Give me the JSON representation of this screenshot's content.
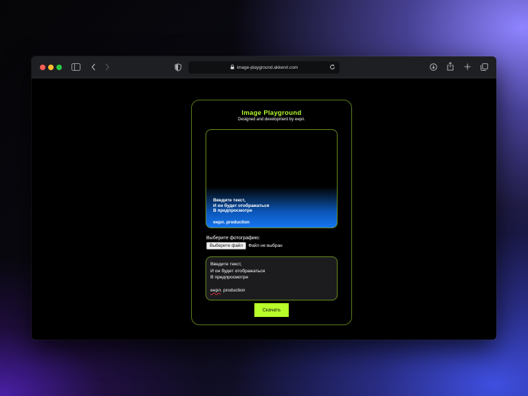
{
  "browser": {
    "url": "image-playground.akkenri.com",
    "controls": {
      "sidebar_icon": "sidebar-icon",
      "back_icon": "chevron-left-icon",
      "forward_icon": "chevron-right-icon",
      "privacy_icon": "shield-icon",
      "download_icon": "download-icon",
      "share_icon": "share-icon",
      "new_tab_icon": "plus-icon",
      "tabs_icon": "tabs-icon",
      "reload_icon": "reload-icon"
    }
  },
  "app": {
    "title": "Image Playground",
    "subtitle": "Designed and development by енрл.",
    "accent_color": "#b8ff2a",
    "preview": {
      "text": "Введите текст,\nИ он будет отображаться\nВ предпросмотре",
      "signature": "енрл. production"
    },
    "file_input": {
      "label": "Выберите фотографию:",
      "button_label": "Выберите файл",
      "status": "Файл не выбран"
    },
    "textarea": {
      "line1": "Введите текст,",
      "line2": "И он будет отображаться",
      "line3": "В предпросмотре",
      "line4": "",
      "line5_word": "енрл",
      "line5_rest": ". production"
    },
    "download_label": "Скачать"
  }
}
